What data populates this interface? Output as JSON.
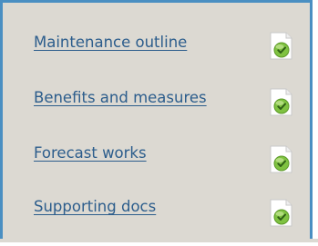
{
  "links": [
    {
      "label": "Maintenance outline",
      "icon": "document-check-icon"
    },
    {
      "label": "Benefits and measures",
      "icon": "document-check-icon"
    },
    {
      "label": "Forecast works",
      "icon": "document-check-icon"
    },
    {
      "label": "Supporting docs",
      "icon": "document-check-icon"
    }
  ],
  "colors": {
    "panel_background": "#dcd9d2",
    "border": "#4a8fc2",
    "link": "#2c5d8c",
    "check_green": "#7fc241"
  }
}
